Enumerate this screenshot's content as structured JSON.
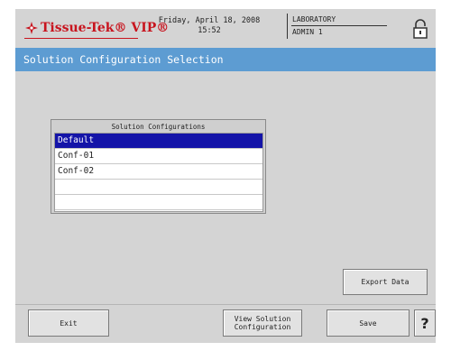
{
  "header": {
    "brand": "Tissue-Tek® VIP®",
    "date": "Friday, April 18, 2008",
    "time": "15:52",
    "location": "LABORATORY",
    "user": "ADMIN 1"
  },
  "title": "Solution Configuration Selection",
  "panel": {
    "title": "Solution Configurations",
    "rows": [
      "Default",
      "Conf-01",
      "Conf-02",
      "",
      ""
    ],
    "selected_index": 0
  },
  "buttons": {
    "export": "Export Data",
    "exit": "Exit",
    "view_line1": "View Solution",
    "view_line2": "Configuration",
    "save": "Save",
    "help": "?"
  },
  "colors": {
    "title_bar": "#5d9cd2",
    "selection": "#1414a8",
    "brand": "#c8141e"
  },
  "icons": {
    "logo": "tissue-tek-logo-icon",
    "lock": "lock-icon"
  }
}
